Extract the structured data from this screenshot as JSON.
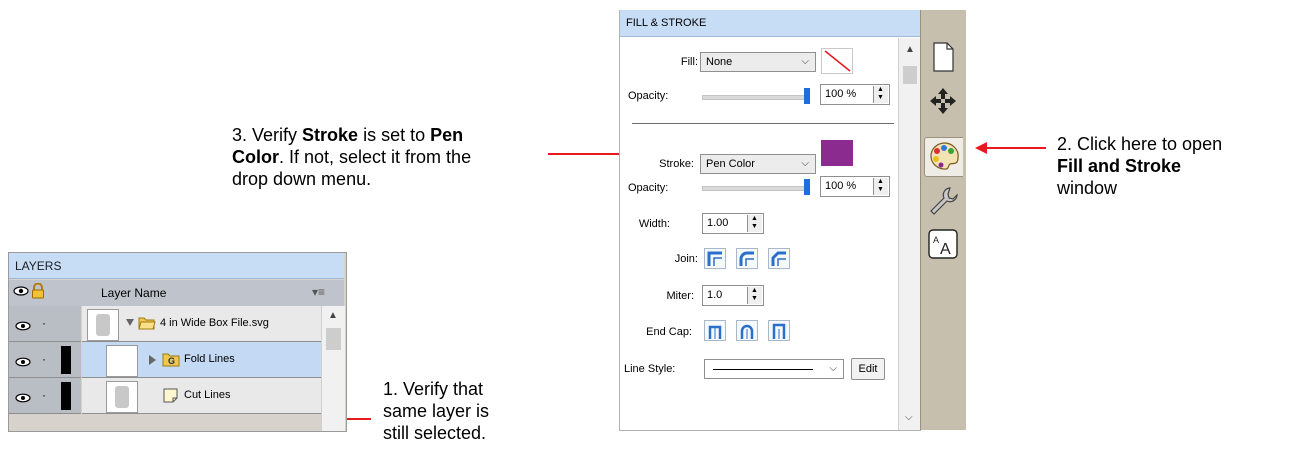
{
  "annotations": {
    "step1": [
      "1. Verify that",
      "same layer is",
      "still selected."
    ],
    "step2": {
      "line1": "2. Click here to open",
      "bold": "Fill and Stroke",
      "line3": "window"
    },
    "step3": {
      "p1": "3. Verify ",
      "b1": "Stroke",
      "p2": " is set to ",
      "b2": "Pen",
      "b3": "Color",
      "p3": ". If not, select it from the",
      "line3": "drop down menu."
    },
    "arrow_color": "#e8191f"
  },
  "layers": {
    "title": "LAYERS",
    "header": {
      "column": "Layer Name",
      "menu_icon": "list-menu-icon"
    },
    "rows": [
      {
        "name": "4 in Wide Box File.svg",
        "type": "folder",
        "expanded": true,
        "selected": false
      },
      {
        "name": "Fold Lines",
        "type": "group",
        "expanded": false,
        "selected": true
      },
      {
        "name": "Cut Lines",
        "type": "layer",
        "selected": false
      }
    ]
  },
  "fill_stroke": {
    "title": "FILL & STROKE",
    "fill": {
      "label": "Fill:",
      "value": "None",
      "swatch": "none"
    },
    "fill_opacity": {
      "label": "Opacity:",
      "value": "100 %"
    },
    "stroke": {
      "label": "Stroke:",
      "value": "Pen Color",
      "swatch": "#8b2a8f"
    },
    "stroke_opacity": {
      "label": "Opacity:",
      "value": "100 %"
    },
    "width": {
      "label": "Width:",
      "value": "1.00"
    },
    "join": {
      "label": "Join:"
    },
    "miter": {
      "label": "Miter:",
      "value": "1.0"
    },
    "endcap": {
      "label": "End Cap:"
    },
    "line_style": {
      "label": "Line Style:",
      "edit_label": "Edit"
    }
  },
  "side_tabs": [
    "document-icon",
    "move-icon",
    "palette-icon",
    "wrench-icon",
    "text-size-icon"
  ],
  "colors": {
    "selected_row": "#c3d9f4",
    "titlebar": "#c7dcf5",
    "slider_knob": "#1f6ee0"
  }
}
